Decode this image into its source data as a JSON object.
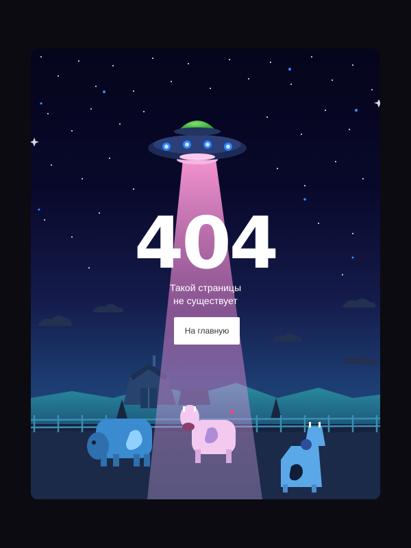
{
  "error": {
    "code": "404",
    "message_line1": "Такой страницы",
    "message_line2": "не существует",
    "home_button": "На главную"
  },
  "colors": {
    "outer_background": "#0b0b11",
    "sky_top": "#05051c",
    "sky_bottom": "#23507d",
    "beam": "#f78fd0",
    "ufo_dome": "#3fbf3a",
    "cow_blue": "#3a8bd0",
    "cow_pink": "#f3c9f0",
    "cow_light_blue": "#5aa8e8"
  }
}
